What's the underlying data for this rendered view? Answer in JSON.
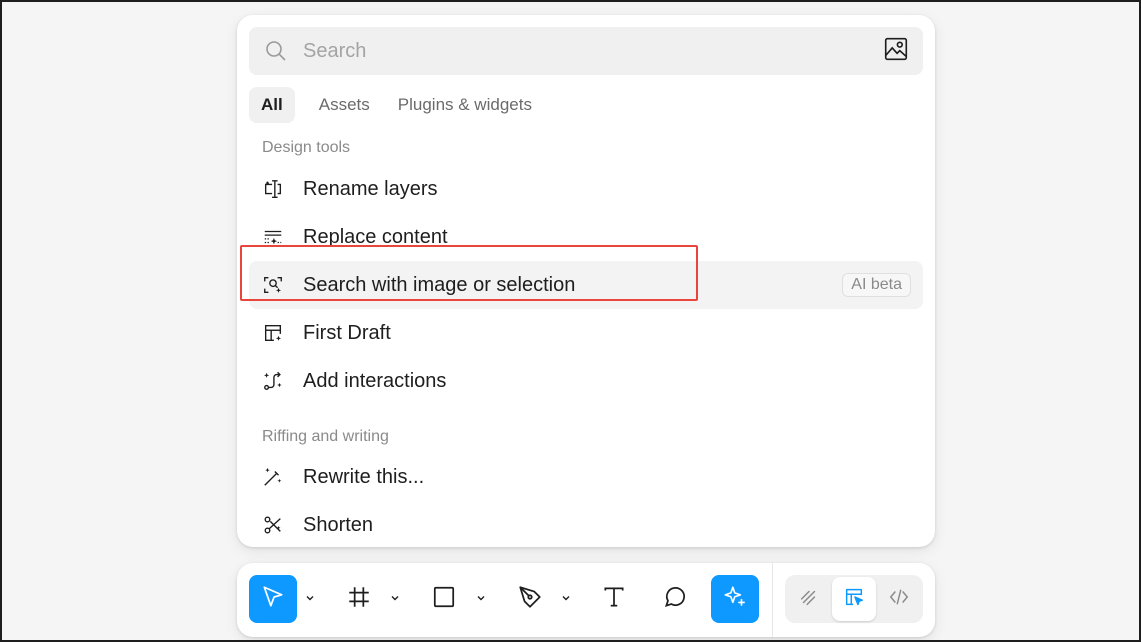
{
  "search": {
    "placeholder": "Search"
  },
  "tabs": [
    {
      "label": "All",
      "active": true
    },
    {
      "label": "Assets",
      "active": false
    },
    {
      "label": "Plugins & widgets",
      "active": false
    }
  ],
  "sections": [
    {
      "header": "Design tools",
      "items": [
        {
          "label": "Rename layers",
          "icon": "rename-layers-icon"
        },
        {
          "label": "Replace content",
          "icon": "replace-content-icon"
        },
        {
          "label": "Search with image or selection",
          "icon": "search-image-selection-icon",
          "badge": "AI beta",
          "highlighted": true
        },
        {
          "label": "First Draft",
          "icon": "first-draft-icon"
        },
        {
          "label": "Add interactions",
          "icon": "add-interactions-icon"
        }
      ]
    },
    {
      "header": "Riffing and writing",
      "items": [
        {
          "label": "Rewrite this...",
          "icon": "magic-wand-icon"
        },
        {
          "label": "Shorten",
          "icon": "shorten-icon"
        }
      ]
    }
  ],
  "toolbar": {
    "tools": [
      "move-tool",
      "frame-tool",
      "rectangle-tool",
      "pen-tool",
      "text-tool",
      "comment-tool",
      "actions-ai-tool"
    ],
    "modes": [
      "draw-mode",
      "design-mode",
      "dev-mode"
    ]
  },
  "colors": {
    "accent": "#0d99ff",
    "highlight": "#e8453c",
    "panel": "#ffffff",
    "background": "#f5f5f5"
  }
}
